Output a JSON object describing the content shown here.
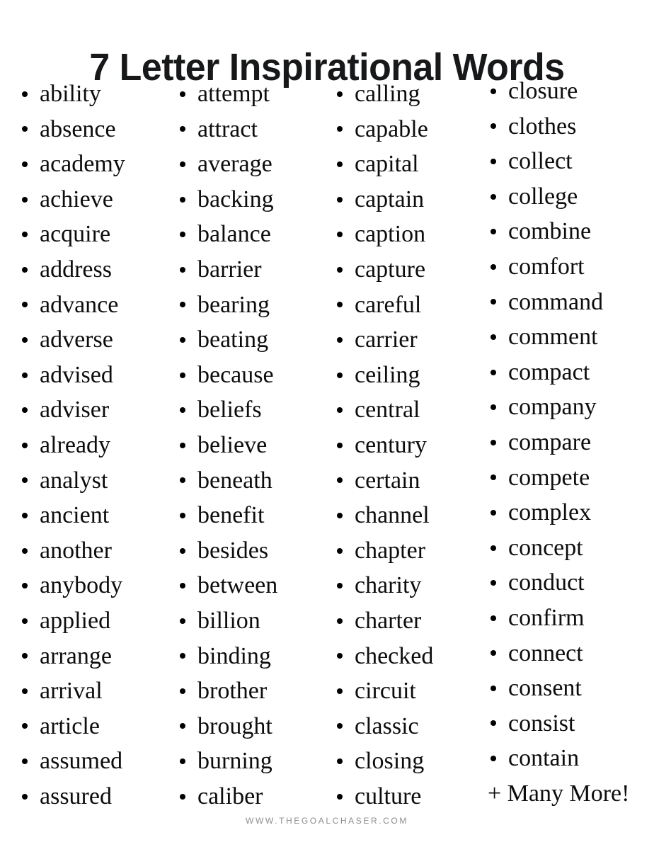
{
  "page": {
    "title": "7 Letter Inspirational Words",
    "background_color": "#ffffff",
    "text_color": "#0d0d0d",
    "footer_color": "#8d8d8d"
  },
  "columns": [
    {
      "id": "column-1",
      "words": [
        "ability",
        "absence",
        "academy",
        "achieve",
        "acquire",
        "address",
        "advance",
        "adverse",
        "advised",
        "adviser",
        "already",
        "analyst",
        "ancient",
        "another",
        "anybody",
        "applied",
        "arrange",
        "arrival",
        "article",
        "assumed",
        "assured"
      ]
    },
    {
      "id": "column-2",
      "words": [
        "attempt",
        "attract",
        "average",
        "backing",
        "balance",
        "barrier",
        "bearing",
        "beating",
        "because",
        "beliefs",
        "believe",
        "beneath",
        "benefit",
        "besides",
        "between",
        "billion",
        "binding",
        "brother",
        "brought",
        "burning",
        "caliber"
      ]
    },
    {
      "id": "column-3",
      "words": [
        "calling",
        "capable",
        "capital",
        "captain",
        "caption",
        "capture",
        "careful",
        "carrier",
        "ceiling",
        "central",
        "century",
        "certain",
        "channel",
        "chapter",
        "charity",
        "charter",
        "checked",
        "circuit",
        "classic",
        "closing",
        "culture"
      ]
    },
    {
      "id": "column-4",
      "words": [
        "closure",
        "clothes",
        "collect",
        "college",
        "combine",
        "comfort",
        "command",
        "comment",
        "compact",
        "company",
        "compare",
        "compete",
        "complex",
        "concept",
        "conduct",
        "confirm",
        "connect",
        "consent",
        "consist",
        "contain"
      ],
      "trailing_note": "+ Many More!"
    }
  ],
  "footer": {
    "url_text": "WWW.THEGOALCHASER.COM"
  }
}
